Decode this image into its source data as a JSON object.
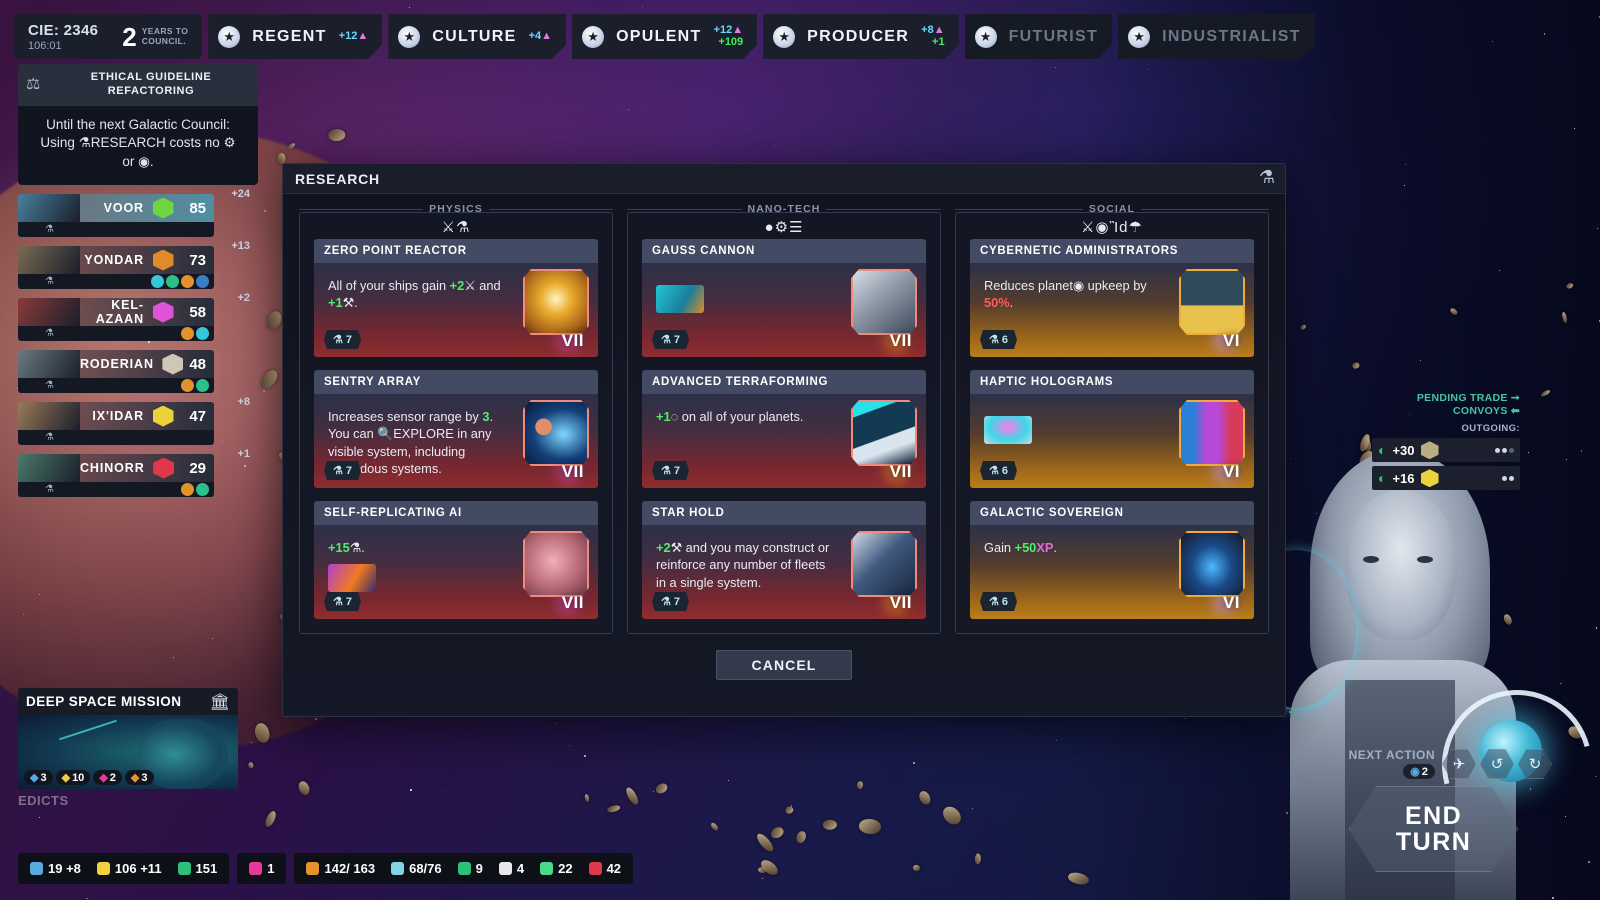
{
  "topbar": {
    "cie_label": "CIE: 2346",
    "cie_sub": "106:01",
    "years_number": "2",
    "years_label_line1": "YEARS TO",
    "years_label_line2": "COUNCIL.",
    "councils": [
      {
        "name": "REGENT",
        "influence": "+12",
        "growth": "",
        "active": true,
        "star_icon": "star-icon"
      },
      {
        "name": "CULTURE",
        "influence": "+4",
        "growth": "",
        "active": true,
        "star_icon": "star-icon"
      },
      {
        "name": "OPULENT",
        "influence": "+12",
        "growth": "+109",
        "active": true,
        "star_icon": "star-icon"
      },
      {
        "name": "PRODUCER",
        "influence": "+8",
        "growth": "+1",
        "active": true,
        "star_icon": "star-icon"
      },
      {
        "name": "FUTURIST",
        "influence": "",
        "growth": "",
        "active": false,
        "star_icon": "star-icon"
      },
      {
        "name": "INDUSTRIALIST",
        "influence": "",
        "growth": "",
        "active": false,
        "star_icon": "star-icon"
      }
    ]
  },
  "edict": {
    "icon": "gavel-icon",
    "title_line1": "ETHICAL GUIDELINE",
    "title_line2": "REFACTORING",
    "body_line1": "Until the next Galactic Council:",
    "body_line2": "Using ⚗RESEARCH costs no ⚙",
    "body_line3": "or ◉."
  },
  "factions": [
    {
      "name": "VOOR",
      "score": "85",
      "delta": "+24",
      "leader": true,
      "emblem_color": "#6fd442",
      "resources": []
    },
    {
      "name": "YONDAR",
      "score": "73",
      "delta": "+13",
      "leader": false,
      "emblem_color": "#e08a2a",
      "resources": [
        "#36c6d9",
        "#2bbf8a",
        "#e2922c",
        "#3a7fc4"
      ]
    },
    {
      "name": "KEL-AZAAN",
      "score": "58",
      "delta": "+2",
      "leader": false,
      "emblem_color": "#e053d6",
      "resources": [
        "#e2922c",
        "#36c6d9"
      ]
    },
    {
      "name": "RODERIAN",
      "score": "48",
      "delta": "",
      "leader": false,
      "emblem_color": "#cfc6b6",
      "resources": [
        "#e2922c",
        "#2bbf8a"
      ]
    },
    {
      "name": "IX'IDAR",
      "score": "47",
      "delta": "+8",
      "leader": false,
      "emblem_color": "#ead23c",
      "resources": []
    },
    {
      "name": "CHINORR",
      "score": "29",
      "delta": "+1",
      "leader": false,
      "emblem_color": "#e0374a",
      "resources": [
        "#e2922c",
        "#2bbf8a"
      ]
    }
  ],
  "research": {
    "header_title": "RESEARCH",
    "header_icon": "flask-icon",
    "cancel_label": "CANCEL",
    "columns": [
      {
        "label": "PHYSICS",
        "icons": "⚔⚗",
        "theme": "physics",
        "cards": [
          {
            "title": "ZERO POINT REACTOR",
            "desc_html": "All of your ships gain <span class=\"grn\">+2</span>⚔ and <span class=\"grn\">+1</span>⚒.",
            "cost": "7",
            "tier": "VII",
            "art_name": "atom-reactor-art",
            "art_css": "radial-gradient(circle at 50% 45%, #fff4c0, #e8a82a 35%, #a8631a 75%, #5b2f12 100%)",
            "inline_art": false
          },
          {
            "title": "SENTRY ARRAY",
            "desc_html": "Increases sensor range by <span class=\"grn\">3</span>. You can 🔍EXPLORE in any visible system, including hazardous systems.",
            "cost": "7",
            "tier": "VII",
            "art_name": "galaxy-sensor-art",
            "art_css": "radial-gradient(circle at 30% 40%, #e08f6a 0 14%, rgba(0,0,0,0) 15%), radial-gradient(ellipse at 62% 52%, #7fd8ff, #14407a 55%, #0a1838 100%)",
            "inline_art": false
          },
          {
            "title": "SELF-REPLICATING AI",
            "desc_html": "<span class=\"grn\">+15</span>⚗.",
            "cost": "7",
            "tier": "VII",
            "art_name": "brain-chip-art",
            "art_css": "radial-gradient(circle at 45% 45%, #f0b0b8, #b86a78 55%, #6d3844 100%)",
            "inline_art": true,
            "inline_art_css": "linear-gradient(120deg, #b040d0, #f07a20 55%, #3a2a6a 100%)"
          }
        ]
      },
      {
        "label": "NANO-TECH",
        "icons": "●⚙☰",
        "theme": "nano",
        "cards": [
          {
            "title": "GAUSS CANNON",
            "desc_html": "",
            "cost": "7",
            "tier": "VII",
            "art_name": "gauss-cannon-art",
            "art_css": "linear-gradient(140deg, #d6dde6, #8d97a6 45%, #424c5c 100%)",
            "inline_art": true,
            "inline_art_css": "linear-gradient(120deg, #22c6d6, #1a7f9a 60%, #e08a2a 100%)"
          },
          {
            "title": "ADVANCED TERRAFORMING",
            "desc_html": "<span class=\"grn\">+1</span>◌ on all of your planets.",
            "cost": "7",
            "tier": "VII",
            "art_name": "terraform-city-art",
            "art_css": "linear-gradient(160deg, #29e0e8 0 18%, #123a52 19% 55%, #d8e4ee 56% 72%, #0c1c34 100%)",
            "inline_art": false
          },
          {
            "title": "STAR HOLD",
            "desc_html": "<span class=\"grn\">+2</span>⚒ and you may construct or reinforce any number of fleets in a single system.",
            "cost": "7",
            "tier": "VII",
            "art_name": "starship-art",
            "art_css": "linear-gradient(135deg, #cfd8e4, #3f5a80 45%, #1a2740 100%)",
            "inline_art": false
          }
        ]
      },
      {
        "label": "SOCIAL",
        "icons": "⚔◉Ἲd☂",
        "theme": "social",
        "cards": [
          {
            "title": "CYBERNETIC ADMINISTRATORS",
            "desc_html": "Reduces planet◉ upkeep by <span class=\"red\">50%</span>.",
            "cost": "6",
            "tier": "VI",
            "art_name": "cybernetic-admins-art",
            "art_css": "linear-gradient(180deg, #2f4a58 0 55%, #e8c24a 56% 100%)",
            "inline_art": false
          },
          {
            "title": "HAPTIC HOLOGRAMS",
            "desc_html": "",
            "cost": "6",
            "tier": "VI",
            "art_name": "haptic-holograms-art",
            "art_css": "linear-gradient(90deg, #2a7fd8 0 20%, #b848d8 40% 60%, #d83a5a 80% 100%)",
            "inline_art": true,
            "inline_art_css": "radial-gradient(ellipse at 50% 40%, #ff7ae8, #3ad8e8 55%, #cfd8e4 100%)"
          },
          {
            "title": "GALACTIC SOVEREIGN",
            "desc_html": "Gain <span class=\"grn\">+50</span><span class=\"pnk\">XP</span>.",
            "cost": "6",
            "tier": "VI",
            "art_name": "galactic-sovereign-art",
            "art_css": "radial-gradient(ellipse at 50% 55%, #4ab8ff, #1a4a88 45%, #151a26 100%)",
            "inline_art": false
          }
        ]
      }
    ]
  },
  "trade": {
    "title_line1": "PENDING TRADE",
    "title_line2": "CONVOYS",
    "outgoing_label": "OUTGOING:",
    "rows": [
      {
        "amount": "+30",
        "icon": "credits-icon",
        "faction_color": "#b9ae83",
        "dots": 3,
        "dots_filled": 2
      },
      {
        "amount": "+16",
        "icon": "credits-icon",
        "faction_color": "#ead23c",
        "dots": 2,
        "dots_filled": 2
      }
    ]
  },
  "mission": {
    "title": "DEEP SPACE MISSION",
    "bank_icon": "bank-icon",
    "edicts_label": "EDICTS",
    "chips": [
      {
        "icon": "pop-icon",
        "value": "3",
        "color": "#5aa8e0"
      },
      {
        "icon": "gear-icon",
        "value": "10",
        "color": "#f2d23c"
      },
      {
        "icon": "research-icon",
        "value": "2",
        "color": "#e8389a"
      },
      {
        "icon": "production-icon",
        "value": "3",
        "color": "#e8922c"
      }
    ]
  },
  "resourcebar": {
    "group1": [
      {
        "icon": "pop-icon",
        "value": "19 +8",
        "color": "#5aa8e0"
      },
      {
        "icon": "gear-icon",
        "value": "106 +11",
        "color": "#f2d23c"
      },
      {
        "icon": "credits-icon",
        "value": "151",
        "color": "#2ec07a"
      }
    ],
    "group2": [
      {
        "icon": "gem-icon",
        "value": "1",
        "color": "#e8389a"
      }
    ],
    "group3": [
      {
        "icon": "production-icon",
        "value": "142/ 163",
        "color": "#e8922c"
      },
      {
        "icon": "science-icon",
        "value": "68/76",
        "color": "#7fd4e8"
      },
      {
        "icon": "trade-icon",
        "value": "9",
        "color": "#2ec07a"
      },
      {
        "icon": "culture-icon",
        "value": "4",
        "color": "#e8e8e8"
      },
      {
        "icon": "food-icon",
        "value": "22",
        "color": "#4ad88a"
      },
      {
        "icon": "military-icon",
        "value": "42",
        "color": "#e03a4a"
      }
    ]
  },
  "endturn": {
    "next_action_label": "NEXT ACTION",
    "next_action_value": "2",
    "next_action_icon": "pop-icon",
    "buttons": [
      {
        "name": "ship-icon",
        "glyph": "✈"
      },
      {
        "name": "undo-icon",
        "glyph": "↺"
      },
      {
        "name": "redo-icon",
        "glyph": "↻"
      }
    ],
    "end_turn_line1": "END",
    "end_turn_line2": "TURN"
  }
}
